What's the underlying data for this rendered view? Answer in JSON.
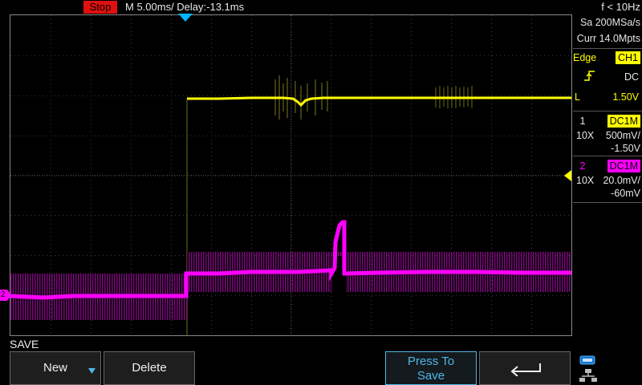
{
  "topbar": {
    "run_state": "Stop",
    "timebase": "M 5.00ms/ Delay:-13.1ms",
    "frequency": "f < 10Hz"
  },
  "acquisition": {
    "sample_rate": "Sa 200MSa/s",
    "memory_depth": "Curr 14.0Mpts"
  },
  "trigger": {
    "type": "Edge",
    "source": "CH1",
    "slope_icon": "rising-edge-icon",
    "coupling": "DC",
    "level_prefix": "L",
    "level": "1.50V"
  },
  "channels": [
    {
      "number": "1",
      "coupling": "DC1M",
      "probe": "10X",
      "scale": "500mV/",
      "offset": "-1.50V",
      "color": "#ffff00"
    },
    {
      "number": "2",
      "coupling": "DC1M",
      "probe": "10X",
      "scale": "20.0mV/",
      "offset": "-60mV",
      "color": "#ff00ff"
    }
  ],
  "markers": {
    "ch2_ground": "2"
  },
  "menu": {
    "title": "SAVE",
    "softkeys": {
      "new": "New",
      "delete": "Delete",
      "press_to_save_line1": "Press To",
      "press_to_save_line2": "Save",
      "back_icon": "return-arrow-icon"
    }
  },
  "status_icons": [
    "usb-icon",
    "network-icon"
  ]
}
